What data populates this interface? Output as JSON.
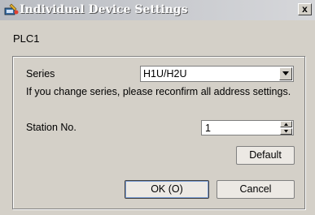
{
  "window": {
    "title": "Individual Device Settings",
    "close_label": "x"
  },
  "device": {
    "name": "PLC1"
  },
  "series": {
    "label": "Series",
    "value": "H1U/H2U",
    "note": "If you change series, please reconfirm all address settings."
  },
  "station": {
    "label": "Station No.",
    "value": "1"
  },
  "buttons": {
    "default": "Default",
    "ok": "OK (O)",
    "cancel": "Cancel"
  }
}
